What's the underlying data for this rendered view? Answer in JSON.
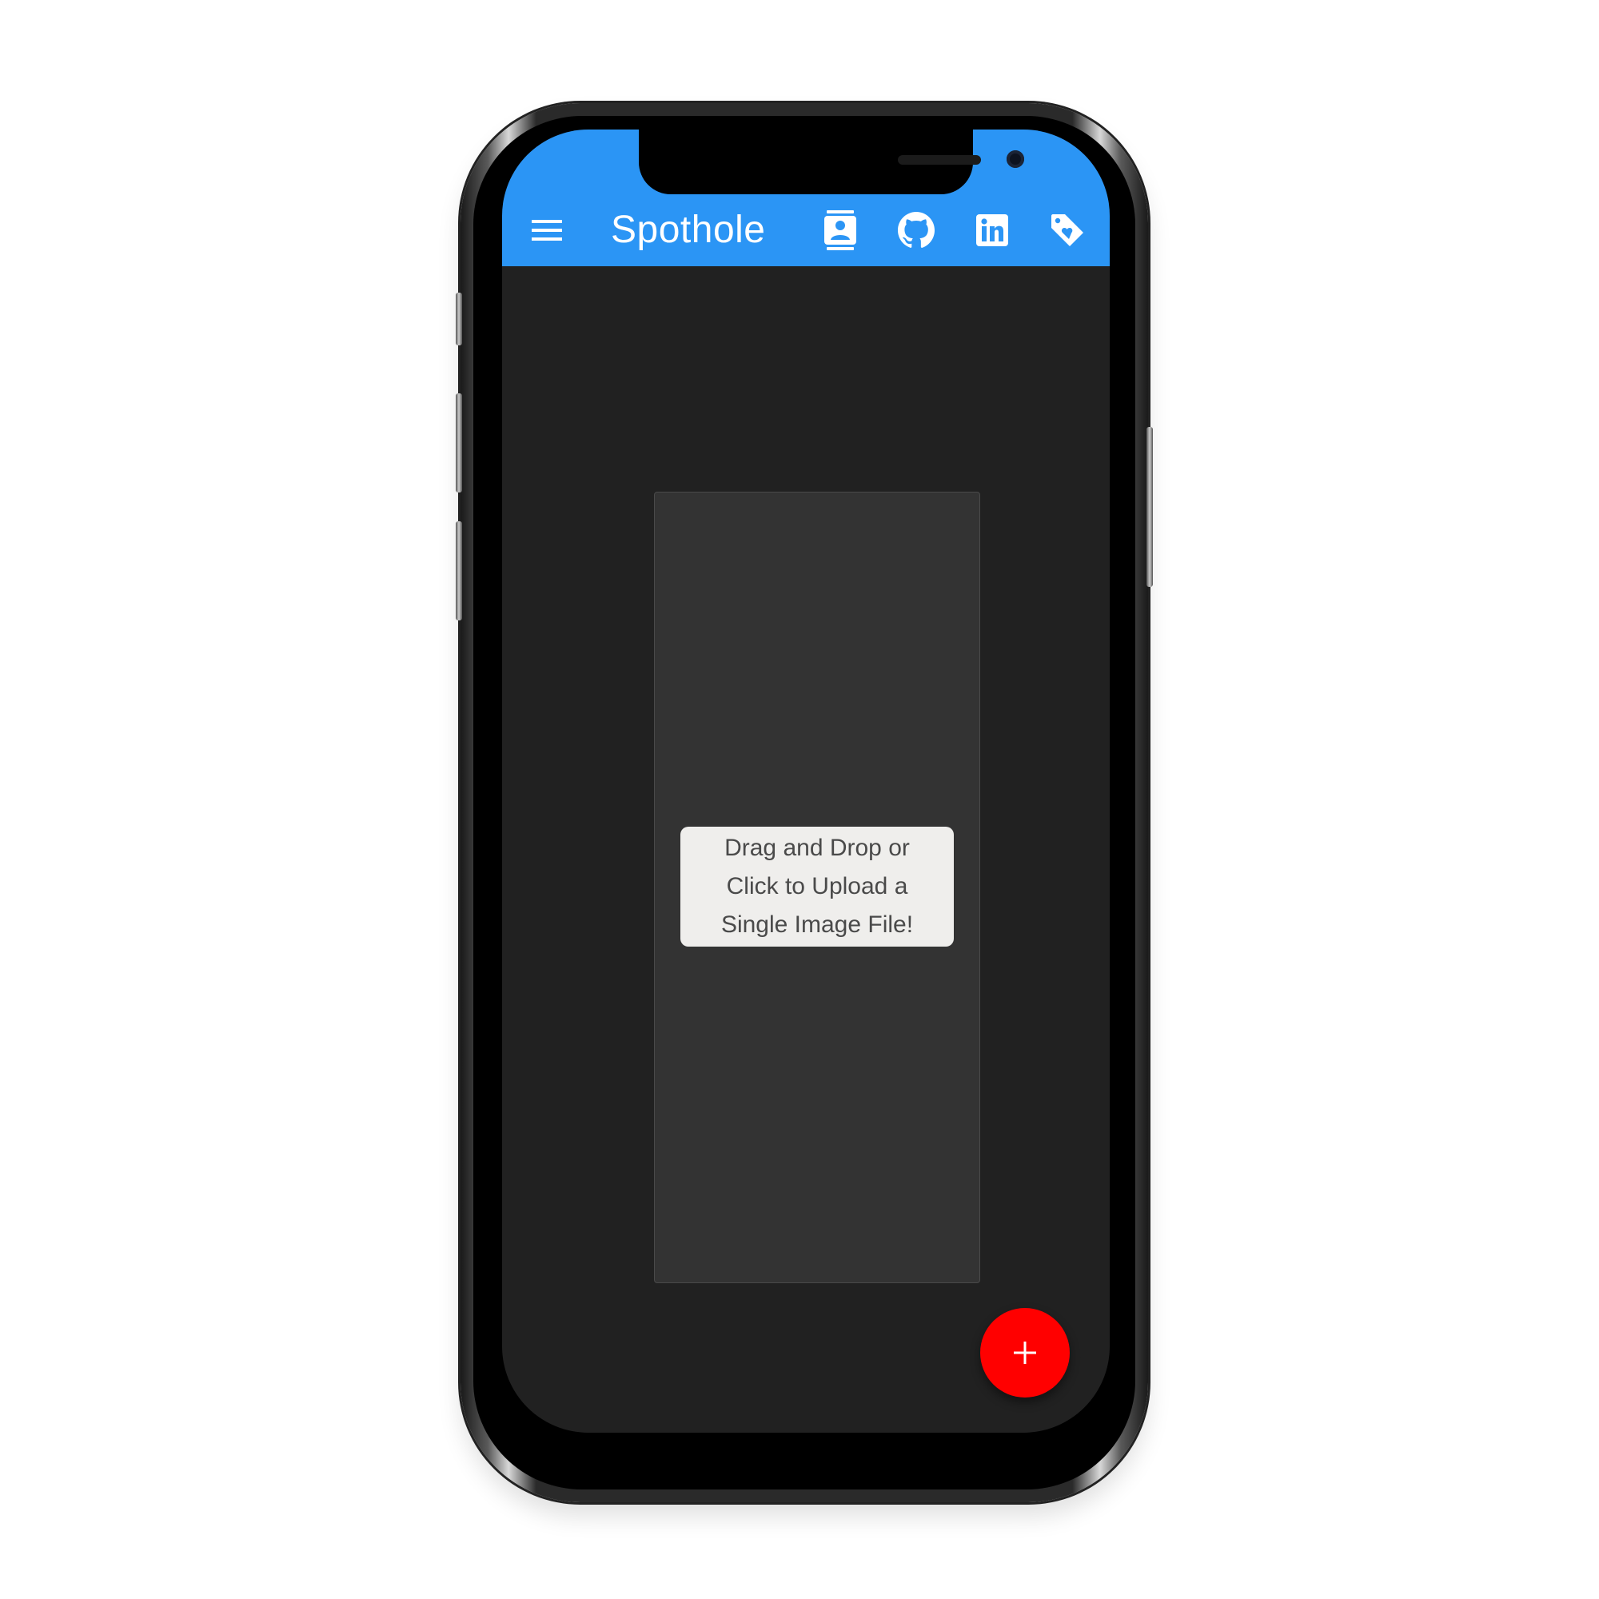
{
  "app": {
    "title": "Spothole"
  },
  "toolbar": {
    "icons": [
      "menu-icon",
      "contact-icon",
      "github-icon",
      "linkedin-icon",
      "tag-heart-icon"
    ]
  },
  "upload": {
    "label": "Drag and Drop or\nClick to Upload a\nSingle Image File!"
  },
  "fab": {
    "icon": "plus-icon"
  },
  "colors": {
    "appbar": "#2b95f5",
    "background": "#212121",
    "dropzone": "#333333",
    "fab": "#ff0000"
  }
}
